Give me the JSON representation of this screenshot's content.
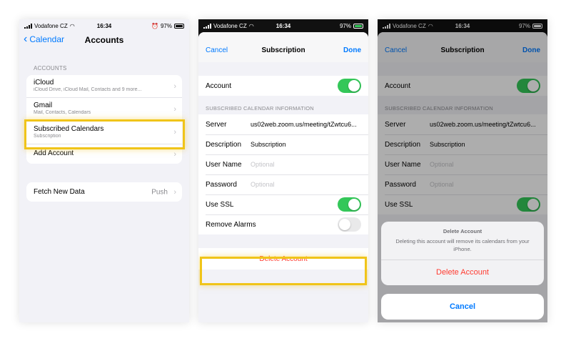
{
  "status": {
    "carrier": "Vodafone CZ",
    "time": "16:34",
    "battery": "97%"
  },
  "panel1": {
    "back_label": "Calendar",
    "title": "Accounts",
    "section_header": "ACCOUNTS",
    "accounts": [
      {
        "name": "iCloud",
        "detail": "iCloud Drive, iCloud Mail, Contacts and 9 more..."
      },
      {
        "name": "Gmail",
        "detail": "Mail, Contacts, Calendars"
      },
      {
        "name": "Subscribed Calendars",
        "detail": "Subscription"
      }
    ],
    "add_account": "Add Account",
    "fetch_label": "Fetch New Data",
    "fetch_value": "Push"
  },
  "sheet": {
    "cancel": "Cancel",
    "title": "Subscription",
    "done": "Done",
    "account_label": "Account",
    "info_header": "SUBSCRIBED CALENDAR INFORMATION",
    "server_label": "Server",
    "server_value": "us02web.zoom.us/meeting/tZwtcu6...",
    "description_label": "Description",
    "description_value": "Subscription",
    "username_label": "User Name",
    "username_placeholder": "Optional",
    "password_label": "Password",
    "password_placeholder": "Optional",
    "ssl_label": "Use SSL",
    "remove_alarms_label": "Remove Alarms",
    "delete_account": "Delete Account"
  },
  "action_sheet": {
    "title": "Delete Account",
    "message": "Deleting this account will remove its calendars from your iPhone.",
    "delete_label": "Delete Account",
    "cancel_label": "Cancel"
  },
  "toggles": {
    "account": true,
    "use_ssl": true,
    "remove_alarms": false
  },
  "colors": {
    "highlight": "#f0c419",
    "accent": "#007aff",
    "destructive": "#ff3b30",
    "toggle_on": "#34c759"
  }
}
